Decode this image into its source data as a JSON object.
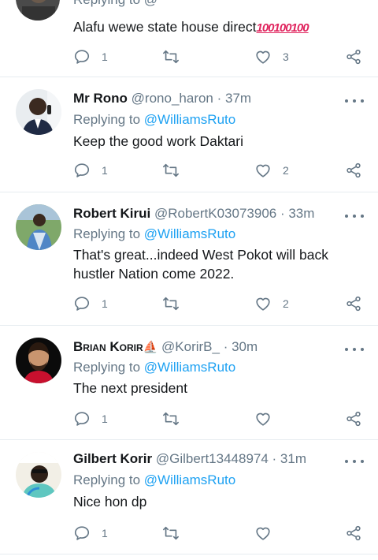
{
  "top_reply": {
    "partial_header": "Replying to @",
    "text": "Alafu wewe state house direct",
    "emoji": "💯💯💯",
    "reply_count": "1",
    "like_count": "3"
  },
  "replies": [
    {
      "name": "Mr Rono",
      "handle": "@rono_haron · 37m",
      "replying_prefix": "Replying to ",
      "replying_to": "@WilliamsRuto",
      "text": "Keep the good work Daktari",
      "reply_count": "1",
      "like_count": "2"
    },
    {
      "name": "Robert Kirui",
      "handle": "@RobertK03073906 · 33m",
      "replying_prefix": "Replying to ",
      "replying_to": "@WilliamsRuto",
      "text": "That's great...indeed West Pokot will back hustler Nation come 2022.",
      "reply_count": "1",
      "like_count": "2"
    },
    {
      "name": "Brian Korir",
      "name_badge": "⛵",
      "handle": "@KorirB_ · 30m",
      "replying_prefix": "Replying to ",
      "replying_to": "@WilliamsRuto",
      "text": "The next president",
      "reply_count": "1",
      "like_count": ""
    },
    {
      "name": "Gilbert Korir",
      "handle": "@Gilbert13448974 · 31m",
      "replying_prefix": "Replying to ",
      "replying_to": "@WilliamsRuto",
      "text": "Nice hon dp",
      "reply_count": "1",
      "like_count": ""
    }
  ],
  "icons": {
    "reply": "reply-icon",
    "retweet": "retweet-icon",
    "like": "heart-icon",
    "share": "share-icon",
    "more": "more-icon"
  },
  "colors": {
    "link": "#1da1f2",
    "secondary_text": "#657786",
    "divider": "#e6ecf0",
    "emoji_red": "#e0245e"
  }
}
